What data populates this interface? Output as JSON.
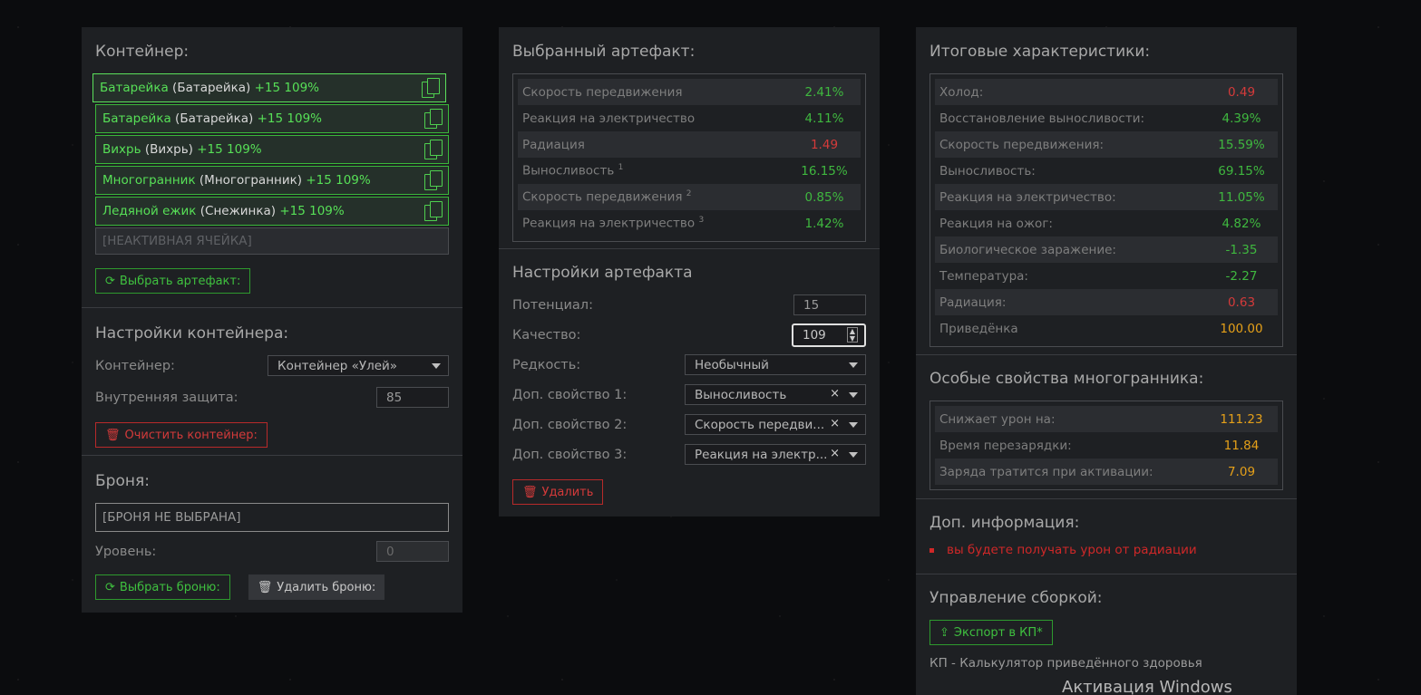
{
  "container_section": {
    "title": "Контейнер:",
    "slots": [
      {
        "name": "Батарейка",
        "type": "(Батарейка)",
        "percent": "+15 109%"
      },
      {
        "name": "Батарейка",
        "type": "(Батарейка)",
        "percent": "+15 109%"
      },
      {
        "name": "Вихрь",
        "type": "(Вихрь)",
        "percent": "+15 109%"
      },
      {
        "name": "Многогранник",
        "type": "(Многогранник)",
        "percent": "+15 109%"
      },
      {
        "name": "Ледяной ежик",
        "type": "(Снежинка)",
        "percent": "+15 109%"
      }
    ],
    "inactive_slot": "[НЕАКТИВНАЯ ЯЧЕЙКА]",
    "select_artifact_button": "Выбрать артефакт:"
  },
  "container_settings": {
    "title": "Настройки контейнера:",
    "container_label": "Контейнер:",
    "container_value": "Контейнер «Улей»",
    "protection_label": "Внутренняя защита:",
    "protection_value": "85",
    "clear_button": "Очистить контейнер:"
  },
  "armor": {
    "title": "Броня:",
    "placeholder": "[БРОНЯ НЕ ВЫБРАНА]",
    "level_label": "Уровень:",
    "level_value": "0",
    "select_button": "Выбрать броню:",
    "delete_button": "Удалить броню:"
  },
  "selected_artifact": {
    "title": "Выбранный артефакт:",
    "stats": [
      {
        "label": "Скорость передвижения",
        "sup": "",
        "value": "2.41%",
        "color": "green"
      },
      {
        "label": "Реакция на электричество",
        "sup": "",
        "value": "4.11%",
        "color": "green"
      },
      {
        "label": "Радиация",
        "sup": "",
        "value": "1.49",
        "color": "red"
      },
      {
        "label": "Выносливость",
        "sup": "1",
        "value": "16.15%",
        "color": "green"
      },
      {
        "label": "Скорость передвижения",
        "sup": "2",
        "value": "0.85%",
        "color": "green"
      },
      {
        "label": "Реакция на электричество",
        "sup": "3",
        "value": "1.42%",
        "color": "green"
      }
    ]
  },
  "artifact_settings": {
    "title": "Настройки артефакта",
    "potential_label": "Потенциал:",
    "potential_value": "15",
    "quality_label": "Качество:",
    "quality_value": "109",
    "rarity_label": "Редкость:",
    "rarity_value": "Необычный",
    "prop1_label": "Доп. свойство 1:",
    "prop1_value": "Выносливость",
    "prop2_label": "Доп. свойство 2:",
    "prop2_value": "Скорость передви...",
    "prop3_label": "Доп. свойство 3:",
    "prop3_value": "Реакция на электр...",
    "delete_button": "Удалить"
  },
  "totals": {
    "title": "Итоговые характеристики:",
    "stats": [
      {
        "label": "Холод:",
        "value": "0.49",
        "color": "red"
      },
      {
        "label": "Восстановление выносливости:",
        "value": "4.39%",
        "color": "green"
      },
      {
        "label": "Скорость передвижения:",
        "value": "15.59%",
        "color": "green"
      },
      {
        "label": "Выносливость:",
        "value": "69.15%",
        "color": "green"
      },
      {
        "label": "Реакция на электричество:",
        "value": "11.05%",
        "color": "green"
      },
      {
        "label": "Реакция на ожог:",
        "value": "4.82%",
        "color": "green"
      },
      {
        "label": "Биологическое заражение:",
        "value": "-1.35",
        "color": "green"
      },
      {
        "label": "Температура:",
        "value": "-2.27",
        "color": "green"
      },
      {
        "label": "Радиация:",
        "value": "0.63",
        "color": "red"
      },
      {
        "label": "Приведёнка",
        "value": "100.00",
        "color": "orange"
      }
    ]
  },
  "special": {
    "title": "Особые свойства многогранника:",
    "stats": [
      {
        "label": "Снижает урон на:",
        "value": "111.23",
        "color": "orange"
      },
      {
        "label": "Время перезарядки:",
        "value": "11.84",
        "color": "orange"
      },
      {
        "label": "Заряда тратится при активации:",
        "value": "7.09",
        "color": "orange"
      }
    ]
  },
  "extra_info": {
    "title": "Доп. информация:",
    "items": [
      "вы будете получать урон от радиации"
    ]
  },
  "build": {
    "title": "Управление сборкой:",
    "export_button": "Экспорт в КП*",
    "footnote": "КП - Калькулятор приведённого здоровья"
  },
  "watermark": "Активация Windows"
}
